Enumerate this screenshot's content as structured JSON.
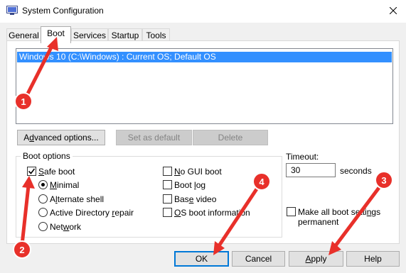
{
  "window": {
    "title": "System Configuration",
    "app_icon": "msconfig-icon",
    "close_glyph": "✕"
  },
  "tabs": [
    {
      "label": "General",
      "active": false
    },
    {
      "label": "Boot",
      "active": true
    },
    {
      "label": "Services",
      "active": false
    },
    {
      "label": "Startup",
      "active": false
    },
    {
      "label": "Tools",
      "active": false
    }
  ],
  "os_list": {
    "items": [
      {
        "text": "Windows 10 (C:\\Windows) : Current OS; Default OS",
        "selected": true
      }
    ]
  },
  "list_buttons": {
    "advanced_prefix": "A",
    "advanced_accel": "d",
    "advanced_suffix": "vanced options...",
    "set_default": "Set as default",
    "delete": "Delete"
  },
  "boot_options": {
    "label": "Boot options",
    "safe_boot": {
      "accel": "S",
      "rest": "afe boot",
      "checked": true
    },
    "minimal": {
      "accel": "M",
      "rest": "inimal",
      "selected": true
    },
    "alternate_shell": {
      "accel": "l",
      "prefix": "A",
      "rest": "ternate shell",
      "selected": false
    },
    "active_directory": {
      "prefix": "Active Directory ",
      "accel": "r",
      "rest": "epair",
      "selected": false
    },
    "network": {
      "prefix": "Net",
      "accel": "w",
      "rest": "ork",
      "selected": false
    },
    "no_gui_boot": {
      "accel": "N",
      "rest": "o GUI boot",
      "checked": false
    },
    "boot_log": {
      "prefix": "Boot ",
      "accel": "l",
      "rest": "og",
      "checked": false
    },
    "base_video": {
      "prefix": "Bas",
      "accel": "e",
      "rest": " video",
      "checked": false
    },
    "os_boot_info": {
      "accel": "O",
      "rest": "S boot information",
      "checked": false
    }
  },
  "timeout": {
    "label": "Timeout:",
    "value": "30",
    "unit": "seconds"
  },
  "make_permanent": {
    "line1_prefix": "Make all boot setti",
    "line1_accel": "n",
    "line1_rest": "gs",
    "line2": "permanent",
    "checked": false
  },
  "dialog_buttons": {
    "ok": "OK",
    "cancel": "Cancel",
    "apply_prefix": "A",
    "apply_accel": "pply",
    "help": "Help"
  },
  "annotations": {
    "color": "#e8302a",
    "badges": [
      "1",
      "2",
      "3",
      "4"
    ]
  }
}
